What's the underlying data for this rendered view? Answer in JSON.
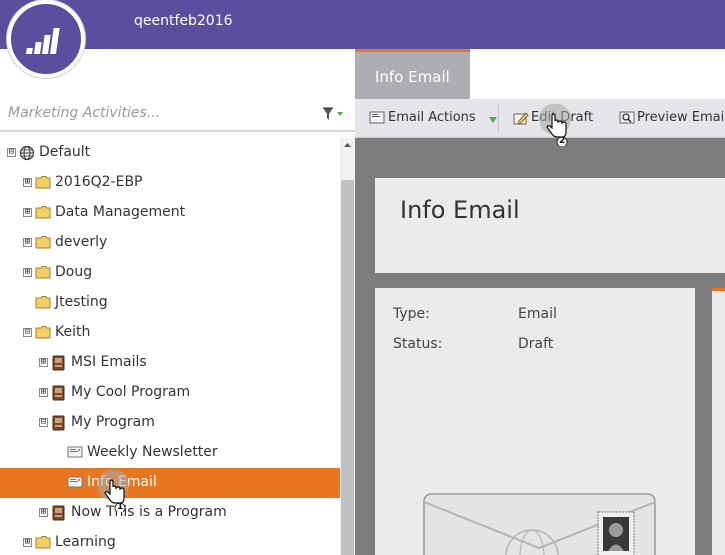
{
  "header": {
    "instance_name": "qeentfeb2016",
    "logo_icon": "marketo-logo-icon",
    "brand_color": "#5b4e9e"
  },
  "search": {
    "placeholder": "Marketing Activities...",
    "filter_icon": "filter-icon"
  },
  "tree": {
    "selected_color": "#e8761f",
    "items": [
      {
        "label": "Default",
        "icon": "globe-icon",
        "expander": "⊟"
      },
      {
        "label": "2016Q2-EBP",
        "icon": "folder-icon",
        "expander": "⊞"
      },
      {
        "label": "Data Management",
        "icon": "folder-icon",
        "expander": "⊞"
      },
      {
        "label": "deverly",
        "icon": "folder-icon",
        "expander": "⊞"
      },
      {
        "label": "Doug",
        "icon": "folder-icon",
        "expander": "⊞"
      },
      {
        "label": "Jtesting",
        "icon": "folder-icon",
        "expander": ""
      },
      {
        "label": "Keith",
        "icon": "folder-icon",
        "expander": "⊟"
      },
      {
        "label": "MSI Emails",
        "icon": "program-icon",
        "expander": "⊞"
      },
      {
        "label": "My Cool Program",
        "icon": "program-icon",
        "expander": "⊞"
      },
      {
        "label": "My Program",
        "icon": "program-icon",
        "expander": "⊟"
      },
      {
        "label": "Weekly Newsletter",
        "icon": "email-icon",
        "expander": ""
      },
      {
        "label": "Info Email",
        "icon": "email-icon",
        "expander": "",
        "selected": true
      },
      {
        "label": "Now This is a Program",
        "icon": "program-icon",
        "expander": "⊞"
      },
      {
        "label": "Learning",
        "icon": "folder-icon",
        "expander": "⊞"
      }
    ]
  },
  "tab": {
    "label": "Info Email"
  },
  "toolbar": {
    "email_actions_label": "Email Actions",
    "edit_draft_label": "Edit Draft",
    "preview_email_label": "Preview Email"
  },
  "main": {
    "title": "Info Email",
    "fields": [
      {
        "label": "Type:",
        "value": "Email"
      },
      {
        "label": "Status:",
        "value": "Draft"
      }
    ]
  },
  "cursors": [
    {
      "number": "1",
      "icon": "hand-pointer-icon"
    },
    {
      "number": "2",
      "icon": "hand-pointer-icon"
    }
  ]
}
